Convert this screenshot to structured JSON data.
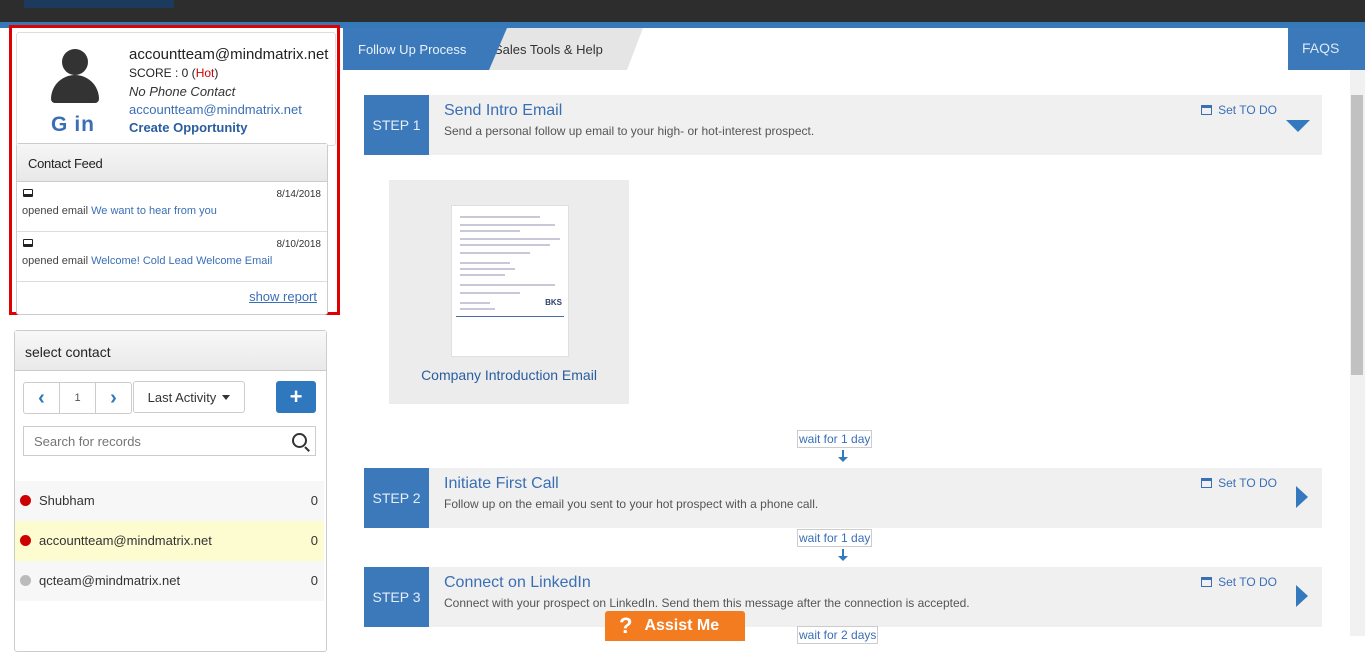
{
  "profile": {
    "email": "accountteam@mindmatrix.net",
    "score_prefix": "SCORE : 0 (",
    "score_hot": "Hot",
    "score_suffix": ")",
    "phone": "No Phone Contact",
    "email_link": "accountteam@mindmatrix.net",
    "create_opportunity": "Create Opportunity",
    "social": [
      "G",
      "in"
    ]
  },
  "feed": {
    "title": "Contact Feed",
    "items": [
      {
        "date": "8/14/2018",
        "action": "opened email ",
        "link": "We want to hear from you"
      },
      {
        "date": "8/10/2018",
        "action": "opened email ",
        "link": "Welcome! Cold Lead Welcome Email"
      }
    ],
    "show_report": "show report"
  },
  "select_contact": {
    "title": "select contact",
    "page": "1",
    "sort": "Last Activity",
    "add": "+",
    "search_placeholder": "Search for records",
    "contacts": [
      {
        "name": "Shubham",
        "count": "0",
        "status_color": "#cc0000"
      },
      {
        "name": "accountteam@mindmatrix.net",
        "count": "0",
        "status_color": "#cc0000"
      },
      {
        "name": "qcteam@mindmatrix.net",
        "count": "0",
        "status_color": "#bbbbbb"
      }
    ]
  },
  "tabs": {
    "active": "Follow Up Process",
    "second": "Sales Tools & Help",
    "faqs": "FAQS"
  },
  "steps": [
    {
      "label": "STEP 1",
      "title": "Send Intro Email",
      "desc": "Send a personal follow up email to your high- or hot-interest prospect.",
      "todo": "Set TO DO"
    },
    {
      "label": "STEP 2",
      "title": "Initiate First Call",
      "desc": "Follow up on the email you sent to your hot prospect with a phone call.",
      "todo": "Set TO DO"
    },
    {
      "label": "STEP 3",
      "title": "Connect on LinkedIn",
      "desc": "Connect with your prospect on LinkedIn. Send them this message after the connection is accepted.",
      "todo": "Set TO DO"
    }
  ],
  "template": {
    "name": "Company Introduction Email",
    "logo_text": "BKS"
  },
  "waits": [
    "wait for 1 day",
    "wait for 1 day",
    "wait for 2 days"
  ],
  "assist": {
    "icon": "?",
    "label": "Assist Me"
  },
  "colors": {
    "accent": "#3b79bb",
    "hot": "#cc0000",
    "assist": "#f47c20",
    "highlight_row": "#fdfbd0",
    "frame": "#e00000"
  }
}
